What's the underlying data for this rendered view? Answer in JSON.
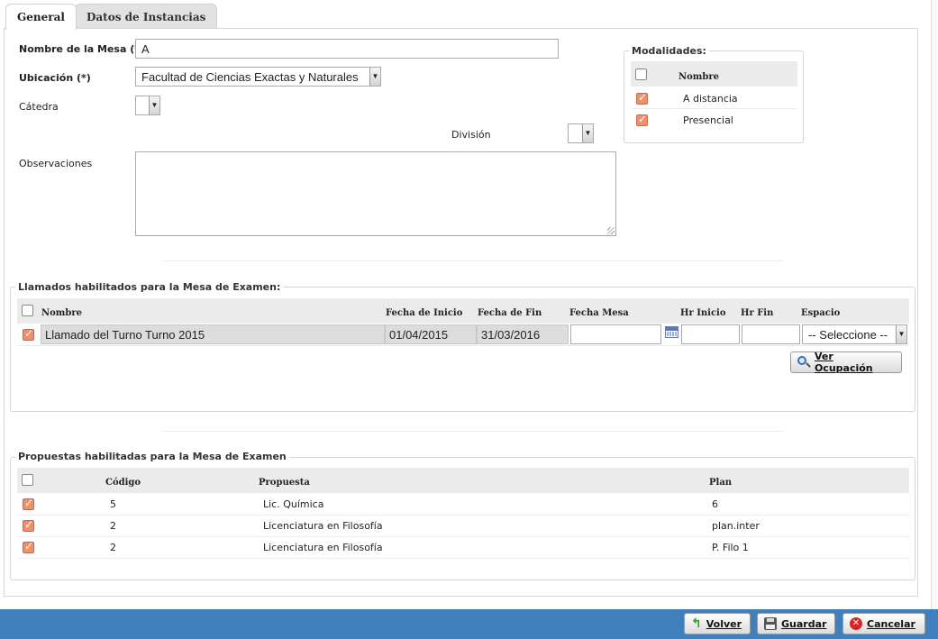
{
  "tabs": [
    {
      "label": "General",
      "active": true
    },
    {
      "label": "Datos de Instancias",
      "active": false
    }
  ],
  "form": {
    "nombre_label": "Nombre de la Mesa (*)",
    "nombre_value": "A",
    "ubicacion_label": "Ubicación (*)",
    "ubicacion_value": "Facultad de Ciencias Exactas y Naturales",
    "catedra_label": "Cátedra",
    "catedra_value": "",
    "division_label": "División",
    "division_value": "",
    "observaciones_label": "Observaciones",
    "observaciones_value": ""
  },
  "modalidades": {
    "legend": "Modalidades:",
    "header_nombre": "Nombre",
    "header_checked": false,
    "items": [
      {
        "label": "A distancia",
        "checked": true
      },
      {
        "label": "Presencial",
        "checked": true
      }
    ]
  },
  "llamados": {
    "legend": "Llamados habilitados para la Mesa de Examen:",
    "headers": {
      "nombre": "Nombre",
      "fecha_inicio": "Fecha de Inicio",
      "fecha_fin": "Fecha de Fin",
      "fecha_mesa": "Fecha Mesa",
      "hr_inicio": "Hr Inicio",
      "hr_fin": "Hr Fin",
      "espacio": "Espacio"
    },
    "rows": [
      {
        "checked": true,
        "nombre": "Llamado del Turno Turno 2015",
        "fecha_inicio": "01/04/2015",
        "fecha_fin": "31/03/2016",
        "fecha_mesa": "",
        "hr_inicio": "",
        "hr_fin": "",
        "espacio": "-- Seleccione --"
      }
    ],
    "ver_ocupacion_label": "Ver Ocupación"
  },
  "propuestas": {
    "legend": "Propuestas habilitadas para la Mesa de Examen",
    "headers": {
      "codigo": "Código",
      "propuesta": "Propuesta",
      "plan": "Plan"
    },
    "rows": [
      {
        "checked": true,
        "codigo": "5",
        "propuesta": "Lic. Química",
        "plan": "6"
      },
      {
        "checked": true,
        "codigo": "2",
        "propuesta": "Licenciatura en Filosofía",
        "plan": "plan.inter"
      },
      {
        "checked": true,
        "codigo": "2",
        "propuesta": "Licenciatura en Filosofía",
        "plan": "P. Filo 1"
      }
    ]
  },
  "footer": {
    "volver_label": "Volver",
    "guardar_label": "Guardar",
    "cancelar_label": "Cancelar"
  },
  "icons": [
    "calendar-icon",
    "magnifier-icon",
    "back-arrow-icon",
    "save-icon",
    "cancel-icon",
    "chevron-down-icon"
  ],
  "colors": {
    "footer_bar": "#3f7fbc",
    "checkbox_checked": "#ef8f6b",
    "header_bg": "#ebebeb"
  }
}
